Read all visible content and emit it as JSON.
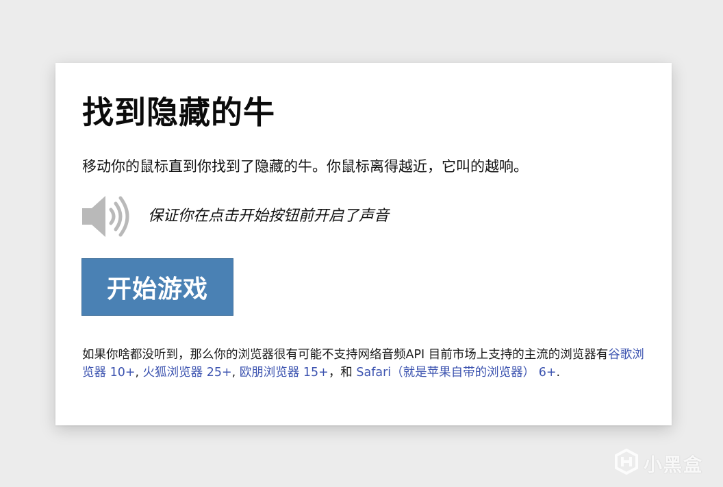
{
  "page": {
    "title": "找到隐藏的牛",
    "intro": "移动你的鼠标直到你找到了隐藏的牛。你鼠标离得越近，它叫的越响。",
    "sound_note": "保证你在点击开始按钮前开启了声音",
    "start_button_label": "开始游戏"
  },
  "footnote": {
    "text_1": "如果你啥都没听到，那么你的浏览器很有可能不支持网络音频API 目前市场上支持的主流的浏览器有",
    "link_chrome": "谷歌浏览器 10+",
    "sep_1": ",",
    "link_firefox": "火狐浏览器 25+",
    "sep_2": ",",
    "link_opera": "欧朋浏览器 15+",
    "sep_3": "，和",
    "link_safari": "Safari（就是苹果自带的浏览器） 6+",
    "text_end": "."
  },
  "watermark": {
    "label": "小黑盒"
  },
  "colors": {
    "background": "#ececec",
    "card": "#ffffff",
    "button": "#4a81b4",
    "link": "#3d54b0",
    "speaker_icon": "#b9b9b9"
  },
  "icons": {
    "speaker": "speaker-volume-icon",
    "watermark_logo": "heybox-logo-icon"
  }
}
